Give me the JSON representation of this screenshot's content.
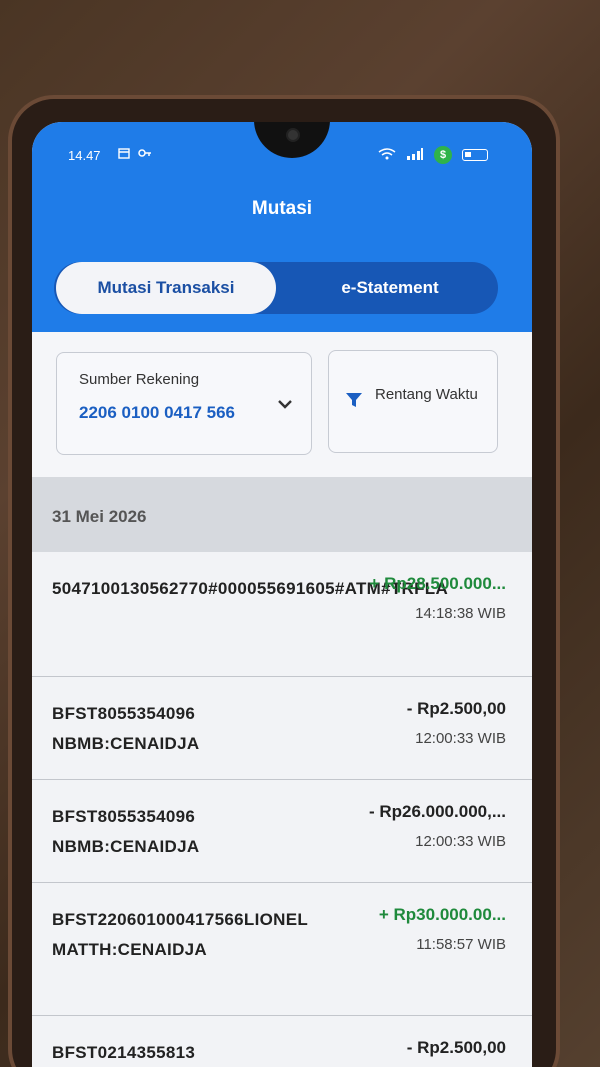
{
  "status_bar": {
    "time": "14.47",
    "icons_left": [
      "calendar-icon",
      "key-icon"
    ],
    "icons_right": [
      "wifi-icon",
      "signal-icon",
      "money-icon",
      "battery-icon"
    ]
  },
  "header": {
    "title": "Mutasi",
    "tabs": [
      {
        "label": "Mutasi Transaksi",
        "active": true
      },
      {
        "label": "e-Statement",
        "active": false
      }
    ]
  },
  "filters": {
    "source_label": "Sumber Rekening",
    "source_value": "2206 0100 0417 566",
    "date_filter_label": "Rentang Waktu"
  },
  "date_group": "31 Mei 2026",
  "transactions": [
    {
      "description": "5047100130562770#000055691605#ATM#TRFLA",
      "amount": "+ Rp28.500.000...",
      "type": "credit",
      "time": "14:18:38 WIB"
    },
    {
      "description": "BFST8055354096 NBMB:CENAIDJA",
      "amount": "- Rp2.500,00",
      "type": "debit",
      "time": "12:00:33 WIB"
    },
    {
      "description": "BFST8055354096 NBMB:CENAIDJA",
      "amount": "- Rp26.000.000,...",
      "type": "debit",
      "time": "12:00:33 WIB"
    },
    {
      "description": "BFST220601000417566LIONEL MATTH:CENAIDJA",
      "amount": "+ Rp30.000.00...",
      "type": "credit",
      "time": "11:58:57 WIB"
    },
    {
      "description": "BFST0214355813",
      "amount": "- Rp2.500,00",
      "type": "debit",
      "time": ""
    }
  ],
  "colors": {
    "primary": "#1f7ce8",
    "credit": "#1f8a3c",
    "debit": "#222222"
  }
}
